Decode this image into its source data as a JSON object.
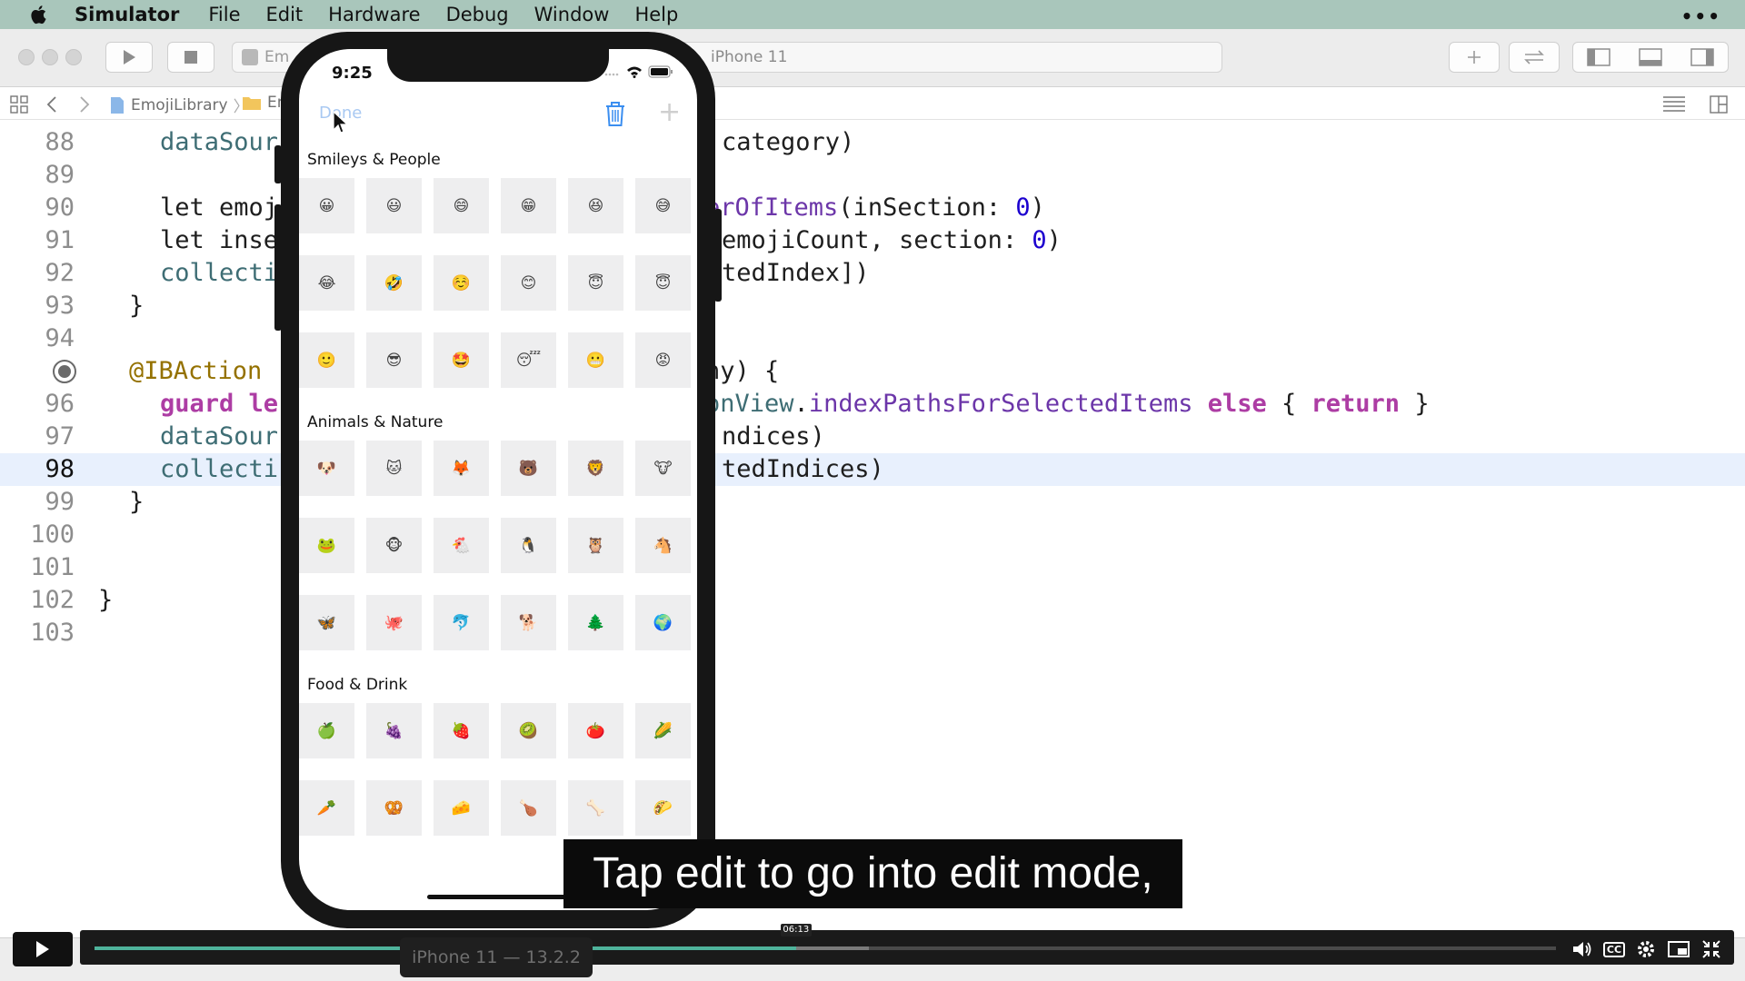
{
  "menubar": {
    "app_name": "Simulator",
    "items": [
      "File",
      "Edit",
      "Hardware",
      "Debug",
      "Window",
      "Help"
    ],
    "more": "•••"
  },
  "toolbar": {
    "scheme_text": "Em",
    "device": "iPhone 11"
  },
  "jumpbar": {
    "project": "EmojiLibrary",
    "folder": "Em"
  },
  "code_lines": [
    {
      "number": "88",
      "text": "dataSour"
    },
    {
      "number": "89",
      "text": ""
    },
    {
      "number": "90",
      "text": "let emoj"
    },
    {
      "number": "91",
      "text": "let inse"
    },
    {
      "number": "92",
      "text": "collecti"
    },
    {
      "number": "93",
      "text": "}"
    },
    {
      "number": "94",
      "text": ""
    },
    {
      "number": "95",
      "text": "@IBAction"
    },
    {
      "number": "96",
      "text": "guard le"
    },
    {
      "number": "97",
      "text": "dataSour"
    },
    {
      "number": "98",
      "text": "collecti"
    },
    {
      "number": "99",
      "text": "}"
    },
    {
      "number": "100",
      "text": ""
    },
    {
      "number": "101",
      "text": ""
    },
    {
      "number": "102",
      "text": "}"
    },
    {
      "number": "103",
      "text": ""
    }
  ],
  "code_right": {
    "l88": "category)",
    "l90a": "erOfItems",
    "l90b": "(inSection: ",
    "l90num": "0",
    "l90c": ")",
    "l91a": "emojiCount, section: ",
    "l91num": "0",
    "l91b": ")",
    "l92": "tedIndex])",
    "l95": "ny) {",
    "l96a": "onView",
    "l96b": ".",
    "l96c": "indexPathsForSelectedItems",
    "l96d": " ",
    "l96else": "else",
    "l96e": " { ",
    "l96ret": "return",
    "l96f": " }",
    "l97": "ndices)",
    "l98": "tedIndices)"
  },
  "phone": {
    "time": "9:25",
    "done_label": "Done",
    "sections": [
      {
        "title": "Smileys & People",
        "rows": [
          [
            "😀",
            "😃",
            "😄",
            "😁",
            "😆",
            "😅"
          ],
          [
            "😂",
            "🤣",
            "☺️",
            "😊",
            "😇",
            "😇"
          ],
          [
            "🙂",
            "😎",
            "🤩",
            "😴",
            "😬",
            "😡"
          ]
        ]
      },
      {
        "title": "Animals & Nature",
        "rows": [
          [
            "🐶",
            "🐱",
            "🦊",
            "🐻",
            "🦁",
            "🐮"
          ],
          [
            "🐸",
            "🐵",
            "🐔",
            "🐧",
            "🦉",
            "🐴"
          ],
          [
            "🦋",
            "🐙",
            "🐬",
            "🐕",
            "🌲",
            "🌍"
          ]
        ]
      },
      {
        "title": "Food & Drink",
        "rows": [
          [
            "🍏",
            "🍇",
            "🍓",
            "🥝",
            "🍅",
            "🌽"
          ],
          [
            "🥕",
            "🥨",
            "🧀",
            "🍗",
            "🦴",
            "🌮"
          ]
        ]
      }
    ]
  },
  "caption": "Tap edit to go into edit mode,",
  "player": {
    "time_label": "06:13",
    "played_fraction": 0.48,
    "buffered_fraction": 0.53,
    "device_pill": "iPhone 11 — 13.2.2",
    "cc_label": "CC"
  },
  "colors": {
    "menubar": "#a9c6bb",
    "keyword": "#ad3da4",
    "progress": "#4fb39b",
    "line_highlight": "#e8f0fd"
  }
}
